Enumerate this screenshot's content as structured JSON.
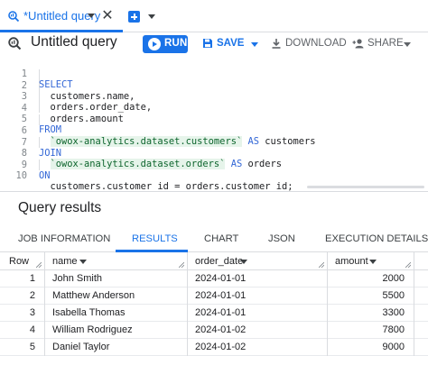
{
  "tab": {
    "label": "*Untitled query",
    "close": "✕"
  },
  "toolbar": {
    "title": "Untitled query",
    "run": "RUN",
    "save": "SAVE",
    "download": "DOWNLOAD",
    "share": "SHARE"
  },
  "editor": {
    "lines": [
      {
        "n": "1",
        "kw": "SELECT",
        "rest": ""
      },
      {
        "n": "2",
        "kw": "",
        "rest": "  customers.name,"
      },
      {
        "n": "3",
        "kw": "",
        "rest": "  orders.order_date,"
      },
      {
        "n": "4",
        "kw": "",
        "rest": "  orders.amount"
      },
      {
        "n": "5",
        "kw": "FROM",
        "rest": ""
      },
      {
        "n": "6",
        "kw": "",
        "str": "`owox-analytics.dataset.customers`",
        "pre": "  ",
        "post": " AS customers",
        "as": "AS"
      },
      {
        "n": "7",
        "kw": "JOIN",
        "rest": ""
      },
      {
        "n": "8",
        "kw": "",
        "str": "`owox-analytics.dataset.orders`",
        "pre": "  ",
        "post": " AS orders",
        "as": "AS"
      },
      {
        "n": "9",
        "kw": "ON",
        "rest": ""
      },
      {
        "n": "10",
        "kw": "",
        "rest": "  customers.customer_id = orders.customer_id;"
      }
    ]
  },
  "results": {
    "title": "Query results",
    "tabs": [
      "JOB INFORMATION",
      "RESULTS",
      "CHART",
      "JSON",
      "EXECUTION DETAILS"
    ],
    "active_tab": "RESULTS",
    "columns": [
      "Row",
      "name",
      "order_date",
      "amount"
    ],
    "rows": [
      [
        "1",
        "John Smith",
        "2024-01-01",
        "2000"
      ],
      [
        "2",
        "Matthew Anderson",
        "2024-01-01",
        "5500"
      ],
      [
        "3",
        "Isabella Thomas",
        "2024-01-01",
        "3300"
      ],
      [
        "4",
        "William Rodriguez",
        "2024-01-02",
        "7800"
      ],
      [
        "5",
        "Daniel Taylor",
        "2024-01-02",
        "9000"
      ]
    ]
  },
  "colors": {
    "accent": "#1a73e8",
    "keyword": "#3367d6",
    "string": "#0d652d"
  }
}
